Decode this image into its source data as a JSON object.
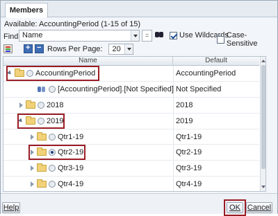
{
  "tab": {
    "label": "Members"
  },
  "available": "Available:  AccountingPeriod (1-15 of 15)",
  "find": {
    "label": "Find:",
    "field_value": "Name",
    "equals": "=",
    "use_wildcards_label": "Use Wildcards",
    "use_wildcards_checked": true,
    "case_sensitive_label": "Case-Sensitive",
    "case_sensitive_checked": false
  },
  "toolbar": {
    "rows_per_page_label": "Rows Per Page:",
    "rows_per_page_value": "20"
  },
  "grid": {
    "columns": {
      "name": "Name",
      "default": "Default"
    },
    "rows": [
      {
        "name": "AccountingPeriod",
        "default": "AccountingPeriod",
        "twisty": "expanded",
        "icon": "folder-icon",
        "selected": false,
        "highlighted": true
      },
      {
        "name": "[AccountingPeriod].[Not Specified]",
        "default": "Not Specified",
        "twisty": "none",
        "icon": "member-icon",
        "selected": false,
        "highlighted": false
      },
      {
        "name": "2018",
        "default": "2018",
        "twisty": "collapsed",
        "icon": "folder-icon",
        "selected": false,
        "highlighted": false
      },
      {
        "name": "2019",
        "default": "2019",
        "twisty": "expanded",
        "icon": "folder-icon",
        "selected": false,
        "highlighted": true
      },
      {
        "name": "Qtr1-19",
        "default": "Qtr1-19",
        "twisty": "collapsed",
        "icon": "folder-icon",
        "selected": false,
        "highlighted": false
      },
      {
        "name": "Qtr2-19",
        "default": "Qtr2-19",
        "twisty": "collapsed",
        "icon": "folder-icon",
        "selected": true,
        "highlighted": true
      },
      {
        "name": "Qtr3-19",
        "default": "Qtr3-19",
        "twisty": "collapsed",
        "icon": "folder-icon",
        "selected": false,
        "highlighted": false
      },
      {
        "name": "Qtr4-19",
        "default": "Qtr4-19",
        "twisty": "collapsed",
        "icon": "folder-icon",
        "selected": false,
        "highlighted": false
      }
    ]
  },
  "footer": {
    "help_label": "Help",
    "ok_label": "OK",
    "cancel_label": "Cancel"
  },
  "colors": {
    "highlight_border": "#9b1c24",
    "folder": "#f1d27a"
  }
}
